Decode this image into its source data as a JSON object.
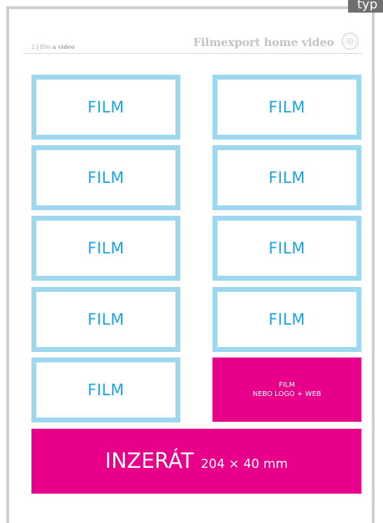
{
  "corner_tag": {
    "text": "typ"
  },
  "header": {
    "page_number": "2",
    "divider": "|",
    "section_italic": "film",
    "section_rest": "a video",
    "title": "Filmexport home video"
  },
  "tiles": [
    {
      "label": "FILM"
    },
    {
      "label": "FILM"
    },
    {
      "label": "FILM"
    },
    {
      "label": "FILM"
    },
    {
      "label": "FILM"
    },
    {
      "label": "FILM"
    },
    {
      "label": "FILM"
    },
    {
      "label": "FILM"
    },
    {
      "label": "FILM"
    }
  ],
  "promo_box": {
    "line1": "FILM",
    "line2": "NEBO LOGO + WEB"
  },
  "ad_banner": {
    "title": "INZERÁT",
    "size": "204 × 40 mm"
  },
  "colors": {
    "tile_border": "#9ed8f0",
    "tile_text": "#1ba4de",
    "magenta": "#e8008a",
    "frame": "#cfcfcf"
  }
}
